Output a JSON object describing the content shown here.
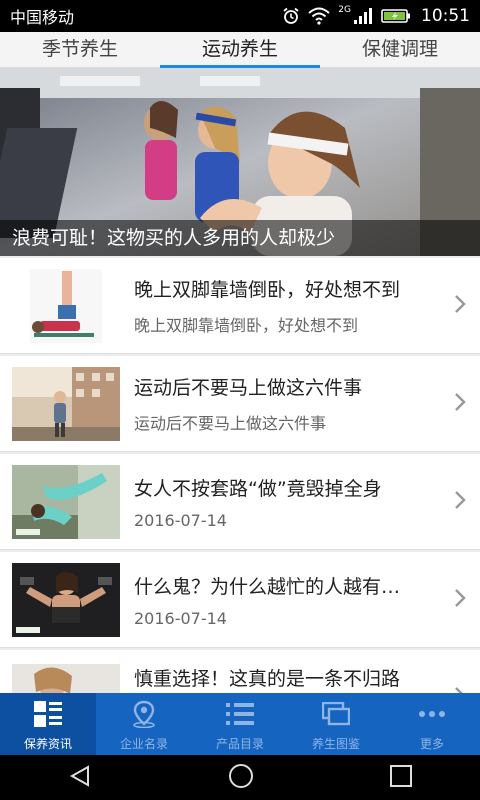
{
  "status_bar": {
    "carrier": "中国移动",
    "network": "2G",
    "time": "10:51"
  },
  "tabs": [
    {
      "label": "季节养生",
      "active": false
    },
    {
      "label": "运动养生",
      "active": true
    },
    {
      "label": "保健调理",
      "active": false
    }
  ],
  "banner": {
    "caption": "浪费可耻！这物买的人多用的人却极少"
  },
  "articles": [
    {
      "title": "晚上双脚靠墙倒卧，好处想不到",
      "sub": "晚上双脚靠墙倒卧，好处想不到"
    },
    {
      "title": "运动后不要马上做这六件事",
      "sub": "运动后不要马上做这六件事"
    },
    {
      "title": "女人不按套路“做”竟毁掉全身",
      "sub": "2016-07-14"
    },
    {
      "title": "什么鬼？为什么越忙的人越有…",
      "sub": "2016-07-14"
    },
    {
      "title": "慎重选择！这真的是一条不归路",
      "sub": ""
    }
  ],
  "bottom_nav": [
    {
      "label": "保养资讯",
      "icon": "news-icon",
      "active": true
    },
    {
      "label": "企业名录",
      "icon": "location-icon",
      "active": false
    },
    {
      "label": "产品目录",
      "icon": "list-icon",
      "active": false
    },
    {
      "label": "养生图鉴",
      "icon": "gallery-icon",
      "active": false
    },
    {
      "label": "更多",
      "icon": "more-icon",
      "active": false
    }
  ],
  "colors": {
    "accent": "#1e88e5",
    "bottom_nav_bg": "#1565c0",
    "bottom_nav_active": "#0d4fa0"
  }
}
